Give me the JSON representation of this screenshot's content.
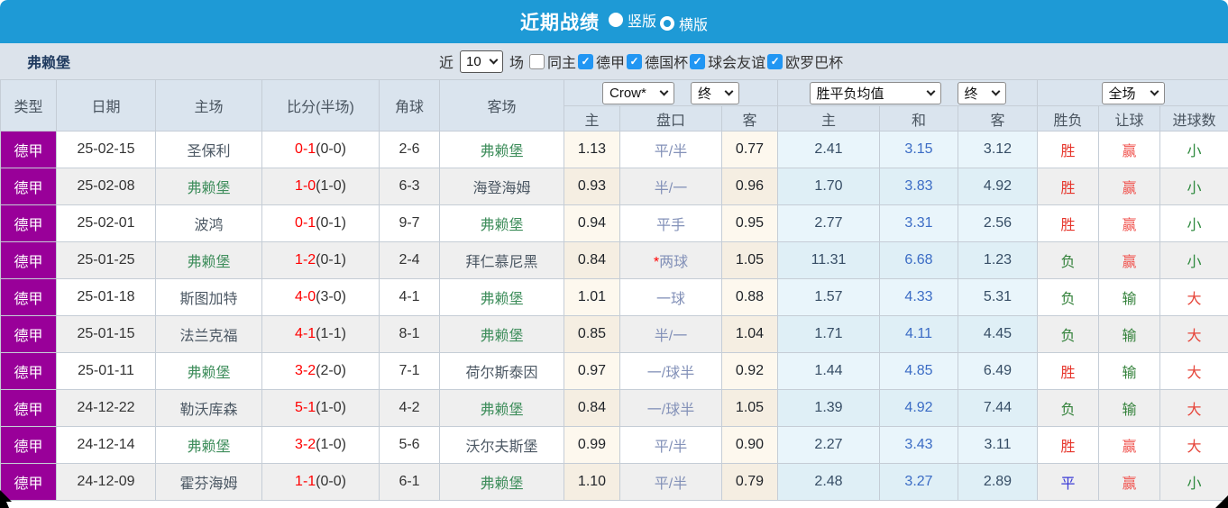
{
  "colors": {
    "accent_blue": "#1e9ad6",
    "checkbox_blue": "#2196f3",
    "league_purple": "#990099",
    "team_green": "#3f8e5c",
    "score_red": "#ff0000",
    "win_red": "#e6352b",
    "loss_green": "#34823b",
    "draw_blue": "#3a3ad6",
    "cover_red": "#f05550",
    "fail_green": "#34823b",
    "over_red": "#e6453a",
    "under_green": "#2f8a3f"
  },
  "titlebar": {
    "title": "近期战绩",
    "radios": [
      {
        "label": "竖版",
        "selected": false
      },
      {
        "label": "横版",
        "selected": true
      }
    ]
  },
  "toolbar": {
    "team": "弗赖堡",
    "near_label": "近",
    "count": "10",
    "games_label": "场",
    "filters": [
      {
        "label": "同主",
        "checked": false
      },
      {
        "label": "德甲",
        "checked": true
      },
      {
        "label": "德国杯",
        "checked": true
      },
      {
        "label": "球会友谊",
        "checked": true
      },
      {
        "label": "欧罗巴杯",
        "checked": true
      }
    ]
  },
  "table": {
    "static_headers": [
      "类型",
      "日期",
      "主场",
      "比分(半场)",
      "角球",
      "客场"
    ],
    "selects": {
      "odds_company": "Crow*",
      "odds_time": "终",
      "avg_type": "胜平负均值",
      "avg_time": "终",
      "scope": "全场"
    },
    "sub_headers": [
      "主",
      "盘口",
      "客",
      "主",
      "和",
      "客",
      "胜负",
      "让球",
      "进球数"
    ],
    "rows": [
      {
        "league": "德甲",
        "date": "25-02-15",
        "home": "圣保利",
        "home_is_focus": false,
        "score": "0-1",
        "half": "(0-0)",
        "corner": "2-6",
        "away": "弗赖堡",
        "away_is_focus": true,
        "odds_home": "1.13",
        "handicap": "平/半",
        "handicap_star": false,
        "odds_away": "0.77",
        "avg_home": "2.41",
        "avg_draw": "3.15",
        "avg_away": "3.12",
        "result": "胜",
        "handicap_result": "赢",
        "goals": "小"
      },
      {
        "league": "德甲",
        "date": "25-02-08",
        "home": "弗赖堡",
        "home_is_focus": true,
        "score": "1-0",
        "half": "(1-0)",
        "corner": "6-3",
        "away": "海登海姆",
        "away_is_focus": false,
        "odds_home": "0.93",
        "handicap": "半/一",
        "handicap_star": false,
        "odds_away": "0.96",
        "avg_home": "1.70",
        "avg_draw": "3.83",
        "avg_away": "4.92",
        "result": "胜",
        "handicap_result": "赢",
        "goals": "小"
      },
      {
        "league": "德甲",
        "date": "25-02-01",
        "home": "波鸿",
        "home_is_focus": false,
        "score": "0-1",
        "half": "(0-1)",
        "corner": "9-7",
        "away": "弗赖堡",
        "away_is_focus": true,
        "odds_home": "0.94",
        "handicap": "平手",
        "handicap_star": false,
        "odds_away": "0.95",
        "avg_home": "2.77",
        "avg_draw": "3.31",
        "avg_away": "2.56",
        "result": "胜",
        "handicap_result": "赢",
        "goals": "小"
      },
      {
        "league": "德甲",
        "date": "25-01-25",
        "home": "弗赖堡",
        "home_is_focus": true,
        "score": "1-2",
        "half": "(0-1)",
        "corner": "2-4",
        "away": "拜仁慕尼黑",
        "away_is_focus": false,
        "odds_home": "0.84",
        "handicap": "两球",
        "handicap_star": true,
        "odds_away": "1.05",
        "avg_home": "11.31",
        "avg_draw": "6.68",
        "avg_away": "1.23",
        "result": "负",
        "handicap_result": "赢",
        "goals": "小"
      },
      {
        "league": "德甲",
        "date": "25-01-18",
        "home": "斯图加特",
        "home_is_focus": false,
        "score": "4-0",
        "half": "(3-0)",
        "corner": "4-1",
        "away": "弗赖堡",
        "away_is_focus": true,
        "odds_home": "1.01",
        "handicap": "一球",
        "handicap_star": false,
        "odds_away": "0.88",
        "avg_home": "1.57",
        "avg_draw": "4.33",
        "avg_away": "5.31",
        "result": "负",
        "handicap_result": "输",
        "goals": "大"
      },
      {
        "league": "德甲",
        "date": "25-01-15",
        "home": "法兰克福",
        "home_is_focus": false,
        "score": "4-1",
        "half": "(1-1)",
        "corner": "8-1",
        "away": "弗赖堡",
        "away_is_focus": true,
        "odds_home": "0.85",
        "handicap": "半/一",
        "handicap_star": false,
        "odds_away": "1.04",
        "avg_home": "1.71",
        "avg_draw": "4.11",
        "avg_away": "4.45",
        "result": "负",
        "handicap_result": "输",
        "goals": "大"
      },
      {
        "league": "德甲",
        "date": "25-01-11",
        "home": "弗赖堡",
        "home_is_focus": true,
        "score": "3-2",
        "half": "(2-0)",
        "corner": "7-1",
        "away": "荷尔斯泰因",
        "away_is_focus": false,
        "odds_home": "0.97",
        "handicap": "一/球半",
        "handicap_star": false,
        "odds_away": "0.92",
        "avg_home": "1.44",
        "avg_draw": "4.85",
        "avg_away": "6.49",
        "result": "胜",
        "handicap_result": "输",
        "goals": "大"
      },
      {
        "league": "德甲",
        "date": "24-12-22",
        "home": "勒沃库森",
        "home_is_focus": false,
        "score": "5-1",
        "half": "(1-0)",
        "corner": "4-2",
        "away": "弗赖堡",
        "away_is_focus": true,
        "odds_home": "0.84",
        "handicap": "一/球半",
        "handicap_star": false,
        "odds_away": "1.05",
        "avg_home": "1.39",
        "avg_draw": "4.92",
        "avg_away": "7.44",
        "result": "负",
        "handicap_result": "输",
        "goals": "大"
      },
      {
        "league": "德甲",
        "date": "24-12-14",
        "home": "弗赖堡",
        "home_is_focus": true,
        "score": "3-2",
        "half": "(1-0)",
        "corner": "5-6",
        "away": "沃尔夫斯堡",
        "away_is_focus": false,
        "odds_home": "0.99",
        "handicap": "平/半",
        "handicap_star": false,
        "odds_away": "0.90",
        "avg_home": "2.27",
        "avg_draw": "3.43",
        "avg_away": "3.11",
        "result": "胜",
        "handicap_result": "赢",
        "goals": "大"
      },
      {
        "league": "德甲",
        "date": "24-12-09",
        "home": "霍芬海姆",
        "home_is_focus": false,
        "score": "1-1",
        "half": "(0-0)",
        "corner": "6-1",
        "away": "弗赖堡",
        "away_is_focus": true,
        "odds_home": "1.10",
        "handicap": "平/半",
        "handicap_star": false,
        "odds_away": "0.79",
        "avg_home": "2.48",
        "avg_draw": "3.27",
        "avg_away": "2.89",
        "result": "平",
        "handicap_result": "赢",
        "goals": "小"
      }
    ]
  }
}
